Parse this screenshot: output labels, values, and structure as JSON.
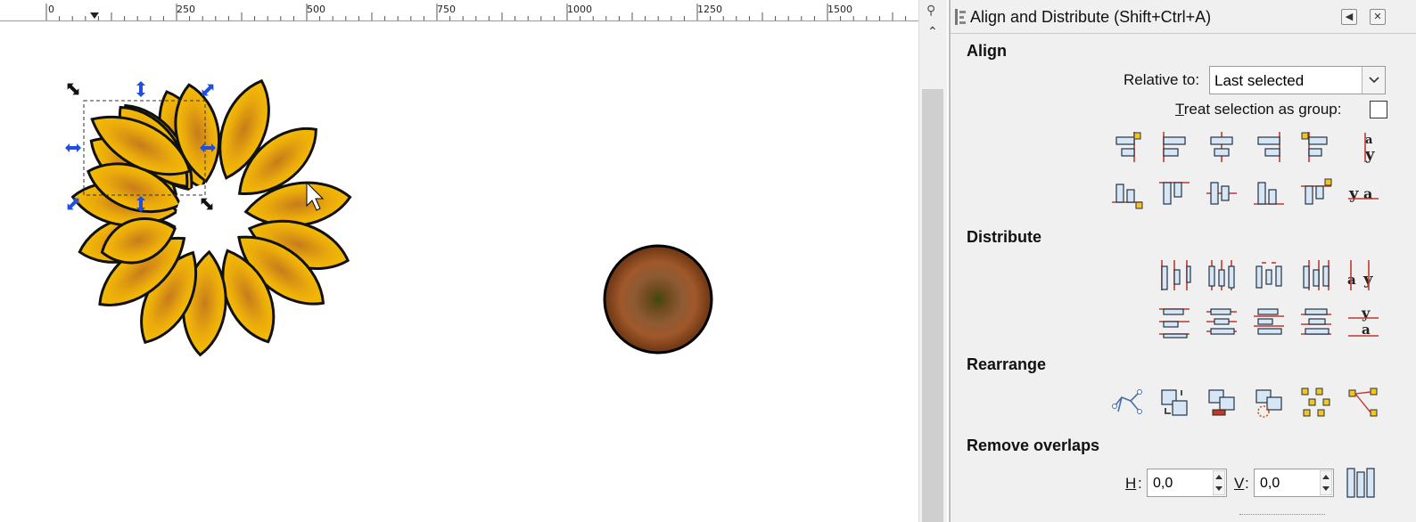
{
  "ruler": {
    "labels": [
      "0",
      "250",
      "500",
      "750",
      "1000",
      "1250",
      "1500"
    ]
  },
  "panel": {
    "title": "Align and Distribute (Shift+Ctrl+A)",
    "align": {
      "heading": "Align",
      "relative_label": "Relative to:",
      "relative_value": "Last selected",
      "group_label_first": "T",
      "group_label_rest": "reat selection as group:"
    },
    "distribute": {
      "heading": "Distribute"
    },
    "rearrange": {
      "heading": "Rearrange"
    },
    "remove_overlaps": {
      "heading": "Remove overlaps",
      "h_label": "H",
      "h_value": "0,0",
      "v_label": "V",
      "v_value": "0,0"
    }
  },
  "icons": {
    "align_row1": [
      "align-right-edge-to-left-icon",
      "align-left-edges-icon",
      "center-on-vertical-axis-icon",
      "align-right-edges-icon",
      "align-left-edge-to-right-icon",
      "align-baselines-horizontal-icon"
    ],
    "align_row2": [
      "align-bottom-edge-to-top-icon",
      "align-top-edges-icon",
      "center-on-horizontal-axis-icon",
      "align-bottom-edges-icon",
      "align-top-edge-to-bottom-icon",
      "align-baselines-vertical-icon"
    ],
    "distribute_row1": [
      "distribute-left-edges-icon",
      "distribute-centers-horizontal-icon",
      "distribute-horizontal-gaps-icon",
      "distribute-right-edges-icon",
      "distribute-baselines-horizontal-icon"
    ],
    "distribute_row2": [
      "distribute-top-edges-icon",
      "distribute-centers-vertical-icon",
      "distribute-vertical-gaps-icon",
      "distribute-bottom-edges-icon",
      "distribute-baselines-vertical-icon"
    ],
    "rearrange_row": [
      "arrange-connector-graph-icon",
      "exchange-selection-order-icon",
      "exchange-z-order-icon",
      "exchange-clockwise-icon",
      "randomize-centers-icon",
      "unclump-objects-icon"
    ]
  },
  "colors": {
    "petal_fill": "#f7c400",
    "petal_shade": "#c77c1a",
    "seed_outer": "#8b4a22",
    "seed_inner": "#5a3a10",
    "handle_blue": "#1f4fe0",
    "panel_bg": "#f0f0f0"
  }
}
